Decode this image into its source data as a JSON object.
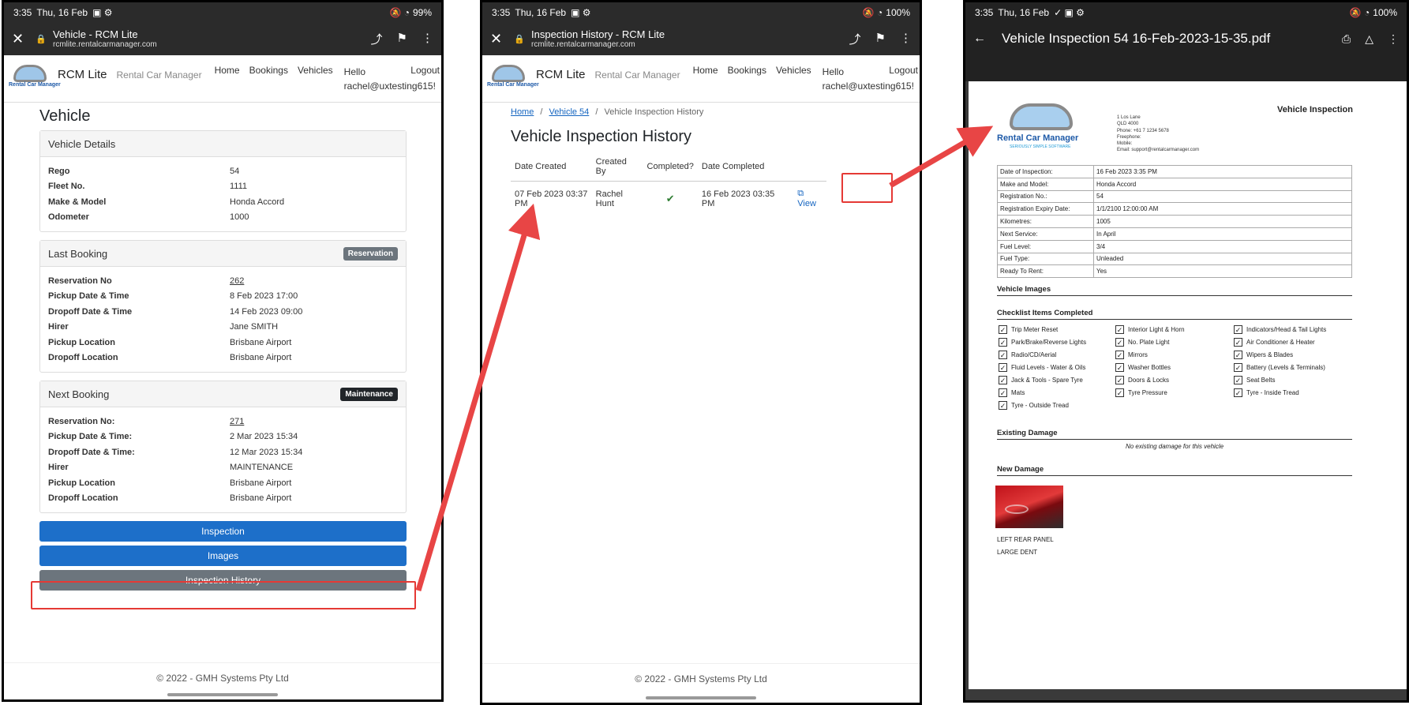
{
  "status": {
    "time": "3:35",
    "date": "Thu, 16 Feb",
    "battery_p1": "99%",
    "battery_p2": "100%",
    "battery_p3": "100%"
  },
  "site": {
    "brand": "RCM Lite",
    "brand_sub": "Rental Car Manager",
    "logo_text": "Rental Car Manager",
    "nav": [
      "Home",
      "Bookings",
      "Vehicles"
    ],
    "hello": "Hello",
    "user": "rachel@uxtesting615!",
    "logout": "Logout",
    "footer": "© 2022 - GMH Systems Pty Ltd"
  },
  "panel1": {
    "tab_title": "Vehicle - RCM Lite",
    "url": "rcmlite.rentalcarmanager.com",
    "heading": "Vehicle",
    "details": {
      "title": "Vehicle Details",
      "rows": [
        {
          "k": "Rego",
          "v": "54"
        },
        {
          "k": "Fleet No.",
          "v": "1111"
        },
        {
          "k": "Make & Model",
          "v": "Honda Accord"
        },
        {
          "k": "Odometer",
          "v": "1000"
        }
      ]
    },
    "last_booking": {
      "title": "Last Booking",
      "badge": "Reservation",
      "badge_color": "#6c757d",
      "rows": [
        {
          "k": "Reservation No",
          "v": "262"
        },
        {
          "k": "Pickup Date & Time",
          "v": "8 Feb 2023 17:00"
        },
        {
          "k": "Dropoff Date & Time",
          "v": "14 Feb 2023 09:00"
        },
        {
          "k": "Hirer",
          "v": "Jane SMITH"
        },
        {
          "k": "Pickup Location",
          "v": "Brisbane Airport"
        },
        {
          "k": "Dropoff Location",
          "v": "Brisbane Airport"
        }
      ]
    },
    "next_booking": {
      "title": "Next Booking",
      "badge": "Maintenance",
      "badge_color": "#212529",
      "rows": [
        {
          "k": "Reservation No:",
          "v": "271"
        },
        {
          "k": "Pickup Date & Time:",
          "v": "2 Mar 2023 15:34"
        },
        {
          "k": "Dropoff Date & Time:",
          "v": "12 Mar 2023 15:34"
        },
        {
          "k": "Hirer",
          "v": "MAINTENANCE"
        },
        {
          "k": "Pickup Location",
          "v": "Brisbane Airport"
        },
        {
          "k": "Dropoff Location",
          "v": "Brisbane Airport"
        }
      ]
    },
    "buttons": {
      "inspection": "Inspection",
      "images": "Images",
      "history": "Inspection History"
    },
    "colors": {
      "primary": "#1d6fc9",
      "secondary": "#6c757d",
      "highlight": "#e53935"
    }
  },
  "panel2": {
    "tab_title": "Inspection History - RCM Lite",
    "url": "rcmlite.rentalcarmanager.com",
    "breadcrumb": [
      "Home",
      "Vehicle 54",
      "Vehicle Inspection History"
    ],
    "heading": "Vehicle Inspection History",
    "columns": [
      "Date Created",
      "Created By",
      "Completed?",
      "Date Completed"
    ],
    "rows": [
      {
        "created": "07 Feb 2023 03:37 PM",
        "by": "Rachel Hunt",
        "completed": "✔",
        "date_completed": "16 Feb 2023 03:35 PM",
        "action": "View"
      }
    ]
  },
  "panel3": {
    "file_title": "Vehicle Inspection 54 16-Feb-2023-15-35.pdf",
    "pdf": {
      "title": "Vehicle Inspection",
      "logo_text": "Rental Car Manager",
      "logo_tag": "SERIOUSLY SIMPLE SOFTWARE",
      "address": [
        "1 Los Lane",
        "QLD 4000",
        "Phone: +61 7 1234 5678",
        "Freephone:",
        "Mobile:",
        "Email: support@rentalcarmanager.com"
      ],
      "fields": [
        {
          "k": "Date of Inspection:",
          "v": "16 Feb 2023 3:35 PM"
        },
        {
          "k": "Make and Model:",
          "v": "Honda Accord"
        },
        {
          "k": "Registration No.:",
          "v": "54"
        },
        {
          "k": "Registration Expiry Date:",
          "v": "1/1/2100 12:00:00 AM"
        },
        {
          "k": "Kilometres:",
          "v": "1005"
        },
        {
          "k": "Next Service:",
          "v": "In April"
        },
        {
          "k": "Fuel Level:",
          "v": "3/4"
        },
        {
          "k": "Fuel Type:",
          "v": "Unleaded"
        },
        {
          "k": "Ready To Rent:",
          "v": "Yes"
        }
      ],
      "sections": {
        "images": "Vehicle Images",
        "checklist": "Checklist Items Completed",
        "existing": "Existing Damage",
        "new_damage": "New Damage"
      },
      "checklist": [
        [
          "Trip Meter Reset",
          "Park/Brake/Reverse Lights",
          "Radio/CD/Aerial",
          "Fluid Levels - Water & Oils",
          "Jack & Tools - Spare Tyre",
          "Mats",
          "Tyre - Outside Tread"
        ],
        [
          "Interior Light & Horn",
          "No. Plate Light",
          "Mirrors",
          "Washer Bottles",
          "Doors & Locks",
          "Tyre Pressure"
        ],
        [
          "Indicators/Head & Tail Lights",
          "Air Conditioner & Heater",
          "Wipers & Blades",
          "Battery (Levels & Terminals)",
          "Seat Belts",
          "Tyre - Inside Tread"
        ]
      ],
      "no_existing": "No existing damage for this vehicle",
      "damage_location": "LEFT REAR PANEL",
      "damage_desc": "LARGE DENT"
    }
  }
}
